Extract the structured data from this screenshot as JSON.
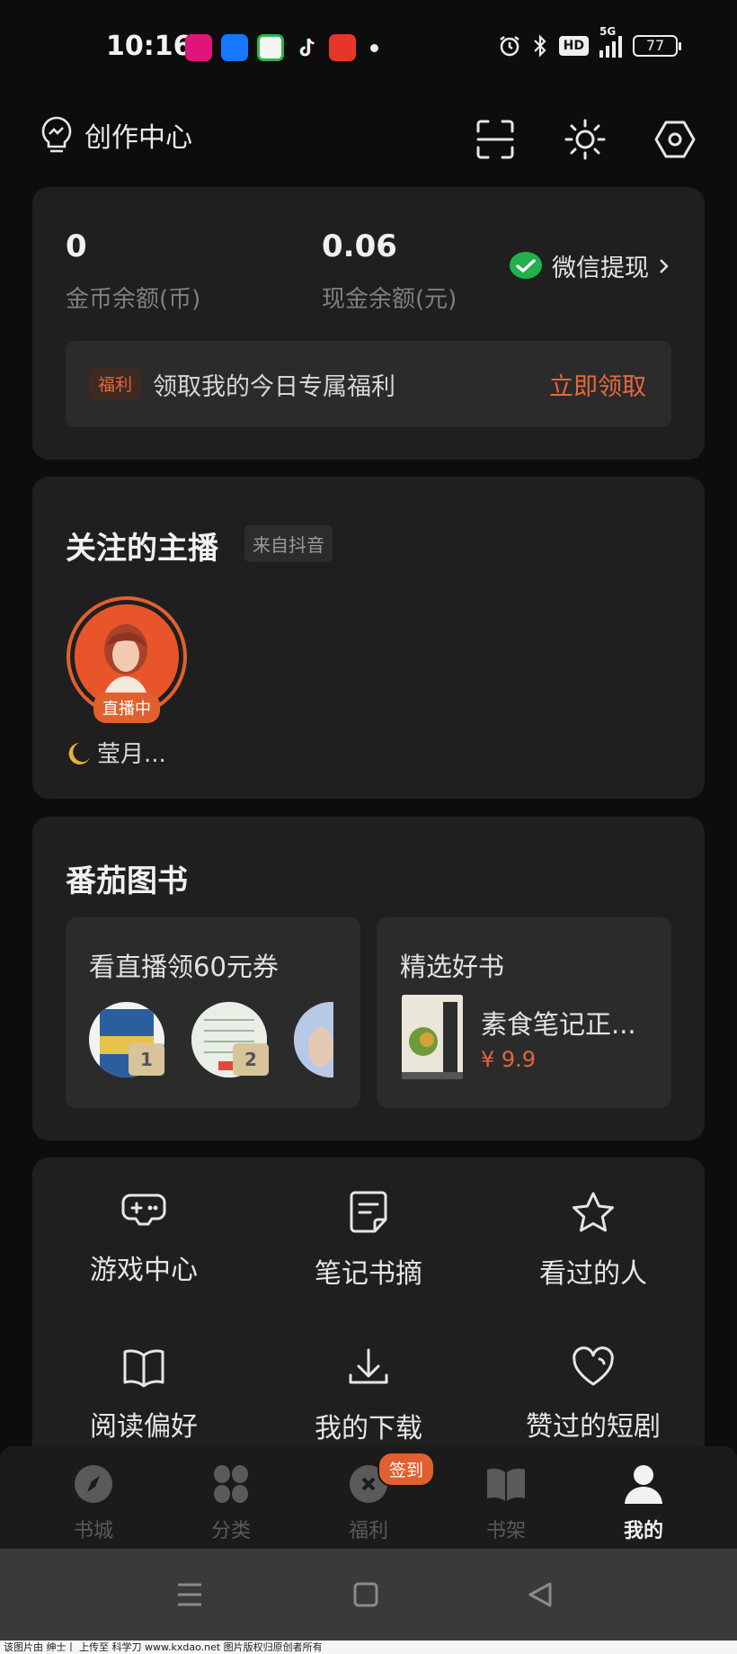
{
  "status_bar": {
    "time": "10:16",
    "battery": "77",
    "network": "5G",
    "hd": "HD"
  },
  "header": {
    "creator_label": "创作中心"
  },
  "wallet": {
    "coins_value": "0",
    "coins_label": "金币余额(币)",
    "cash_value": "0.06",
    "cash_label": "现金余额(元)",
    "withdraw_label": "微信提现",
    "benefit_tag": "福利",
    "benefit_text": "领取我的今日专属福利",
    "benefit_action": "立即领取"
  },
  "follow": {
    "title": "关注的主播",
    "source_badge": "来自抖音",
    "live_tag": "直播中",
    "anchor_name": "莹月..."
  },
  "books": {
    "title": "番茄图书",
    "live_card_title": "看直播领60元券",
    "rank_1": "1",
    "rank_2": "2",
    "picks_title": "精选好书",
    "book_name": "素食笔记正...",
    "book_price": "¥ 9.9"
  },
  "menu": {
    "items": [
      {
        "label": "游戏中心",
        "icon": "gamepad-icon"
      },
      {
        "label": "笔记书摘",
        "icon": "note-icon"
      },
      {
        "label": "看过的人",
        "icon": "star-icon"
      },
      {
        "label": "阅读偏好",
        "icon": "open-book-icon"
      },
      {
        "label": "我的下载",
        "icon": "download-icon"
      },
      {
        "label": "赞过的短剧",
        "icon": "heart-icon"
      }
    ]
  },
  "bottom_nav": {
    "sign_badge": "签到",
    "items": [
      {
        "label": "书城",
        "icon": "compass-icon"
      },
      {
        "label": "分类",
        "icon": "category-icon"
      },
      {
        "label": "福利",
        "icon": "gift-icon"
      },
      {
        "label": "书架",
        "icon": "bookshelf-icon"
      },
      {
        "label": "我的",
        "icon": "profile-icon"
      }
    ],
    "active": "我的"
  },
  "watermark": "该图片由 绅士丨 上传至 科学刀 www.kxdao.net 图片版权归原创者所有",
  "colors": {
    "accent": "#e0602f",
    "background": "#0d0d0d",
    "card": "#1f1f1f",
    "wechat_green": "#22b14c"
  }
}
